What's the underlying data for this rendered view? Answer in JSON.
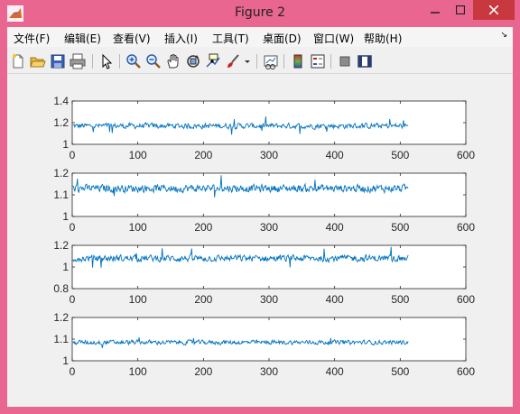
{
  "window": {
    "title": "Figure 2"
  },
  "menu": [
    "文件(F)",
    "编辑(E)",
    "查看(V)",
    "插入(I)",
    "工具(T)",
    "桌面(D)",
    "窗口(W)",
    "帮助(H)"
  ],
  "toolbar": {
    "icons": [
      "new-figure-icon",
      "open-file-icon",
      "save-icon",
      "print-icon",
      "edit-plot-arrow-icon",
      "zoom-in-icon",
      "zoom-out-icon",
      "pan-hand-icon",
      "rotate-3d-icon",
      "data-cursor-icon",
      "brush-icon",
      "link-plot-icon",
      "colorbar-icon",
      "legend-icon",
      "hide-plot-tools-icon",
      "show-plot-tools-icon"
    ]
  },
  "colors": {
    "line": "#0072bd",
    "window_frame": "#e8668f",
    "close_button": "#c7383f"
  },
  "chart_data": [
    {
      "type": "line",
      "xlim": [
        0,
        600
      ],
      "ylim": [
        1,
        1.4
      ],
      "yticks": [
        "1",
        "1.2",
        "1.4"
      ],
      "xticks": [
        "0",
        "100",
        "200",
        "300",
        "400",
        "500",
        "600"
      ],
      "series": [
        {
          "n": 512,
          "center": 1.17,
          "amp": 0.05
        }
      ]
    },
    {
      "type": "line",
      "xlim": [
        0,
        600
      ],
      "ylim": [
        1,
        1.2
      ],
      "yticks": [
        "1",
        "1.1",
        "1.2"
      ],
      "xticks": [
        "0",
        "100",
        "200",
        "300",
        "400",
        "500",
        "600"
      ],
      "series": [
        {
          "n": 512,
          "center": 1.13,
          "amp": 0.035
        }
      ]
    },
    {
      "type": "line",
      "xlim": [
        0,
        600
      ],
      "ylim": [
        0.8,
        1.2
      ],
      "yticks": [
        "0.8",
        "1",
        "1.2"
      ],
      "xticks": [
        "0",
        "100",
        "200",
        "300",
        "400",
        "500",
        "600"
      ],
      "series": [
        {
          "n": 512,
          "center": 1.08,
          "amp": 0.06
        }
      ]
    },
    {
      "type": "line",
      "xlim": [
        0,
        600
      ],
      "ylim": [
        1,
        1.2
      ],
      "yticks": [
        "1",
        "1.1",
        "1.2"
      ],
      "xticks": [
        "0",
        "100",
        "200",
        "300",
        "400",
        "500",
        "600"
      ],
      "series": [
        {
          "n": 512,
          "center": 1.085,
          "amp": 0.02
        }
      ]
    }
  ]
}
